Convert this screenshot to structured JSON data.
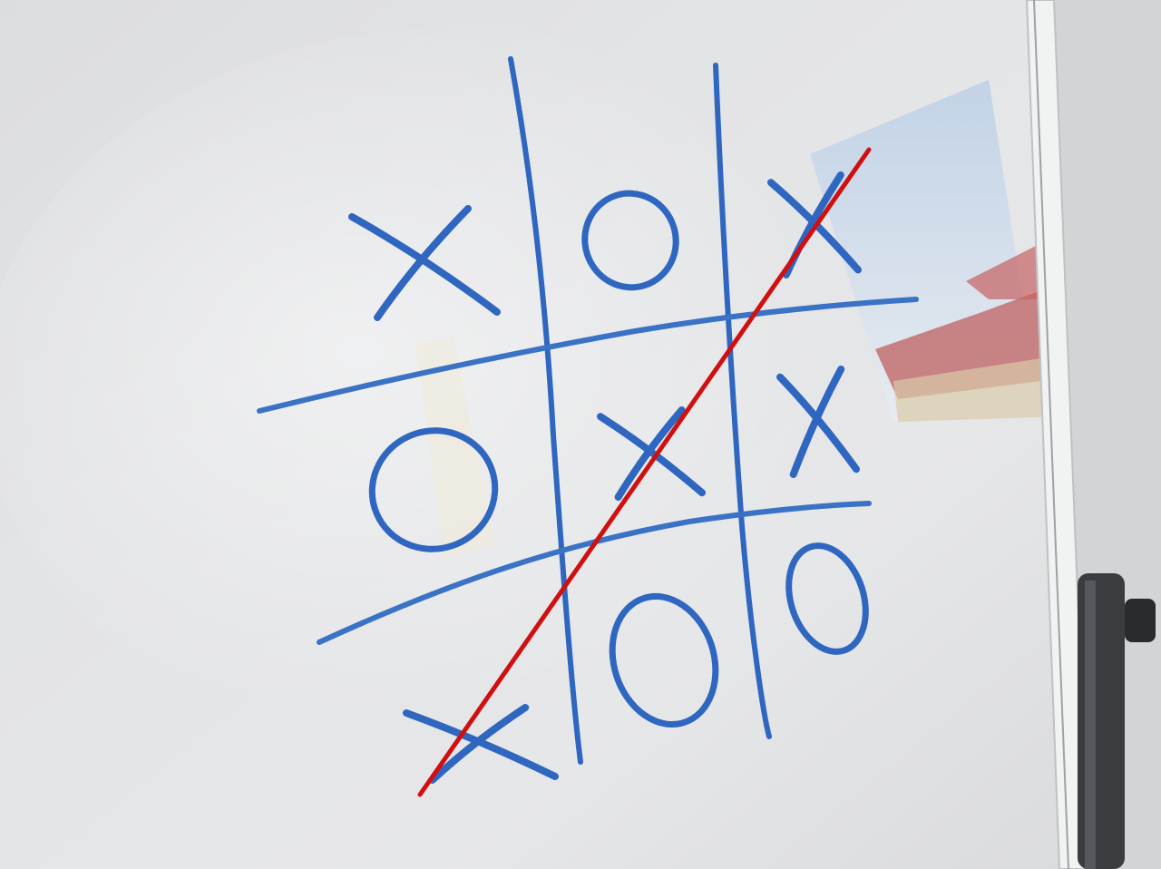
{
  "game": {
    "type": "tic-tac-toe",
    "surface": "whiteboard",
    "board": [
      [
        "X",
        "O",
        "X"
      ],
      [
        "O",
        "X",
        "X"
      ],
      [
        "X",
        "O",
        "O"
      ]
    ],
    "winner": "X",
    "winning_line": {
      "from_cell": [
        2,
        0
      ],
      "to_cell": [
        0,
        2
      ],
      "direction": "anti-diagonal"
    }
  },
  "colors": {
    "marker": "#2f66c0",
    "win_line": "#d01010",
    "board_surface": "#e4e5e7",
    "frame": "#f2f3f3",
    "window_sky": "#c9d9ea",
    "roof": "#b23a3a",
    "stand": "#3a3c40"
  }
}
